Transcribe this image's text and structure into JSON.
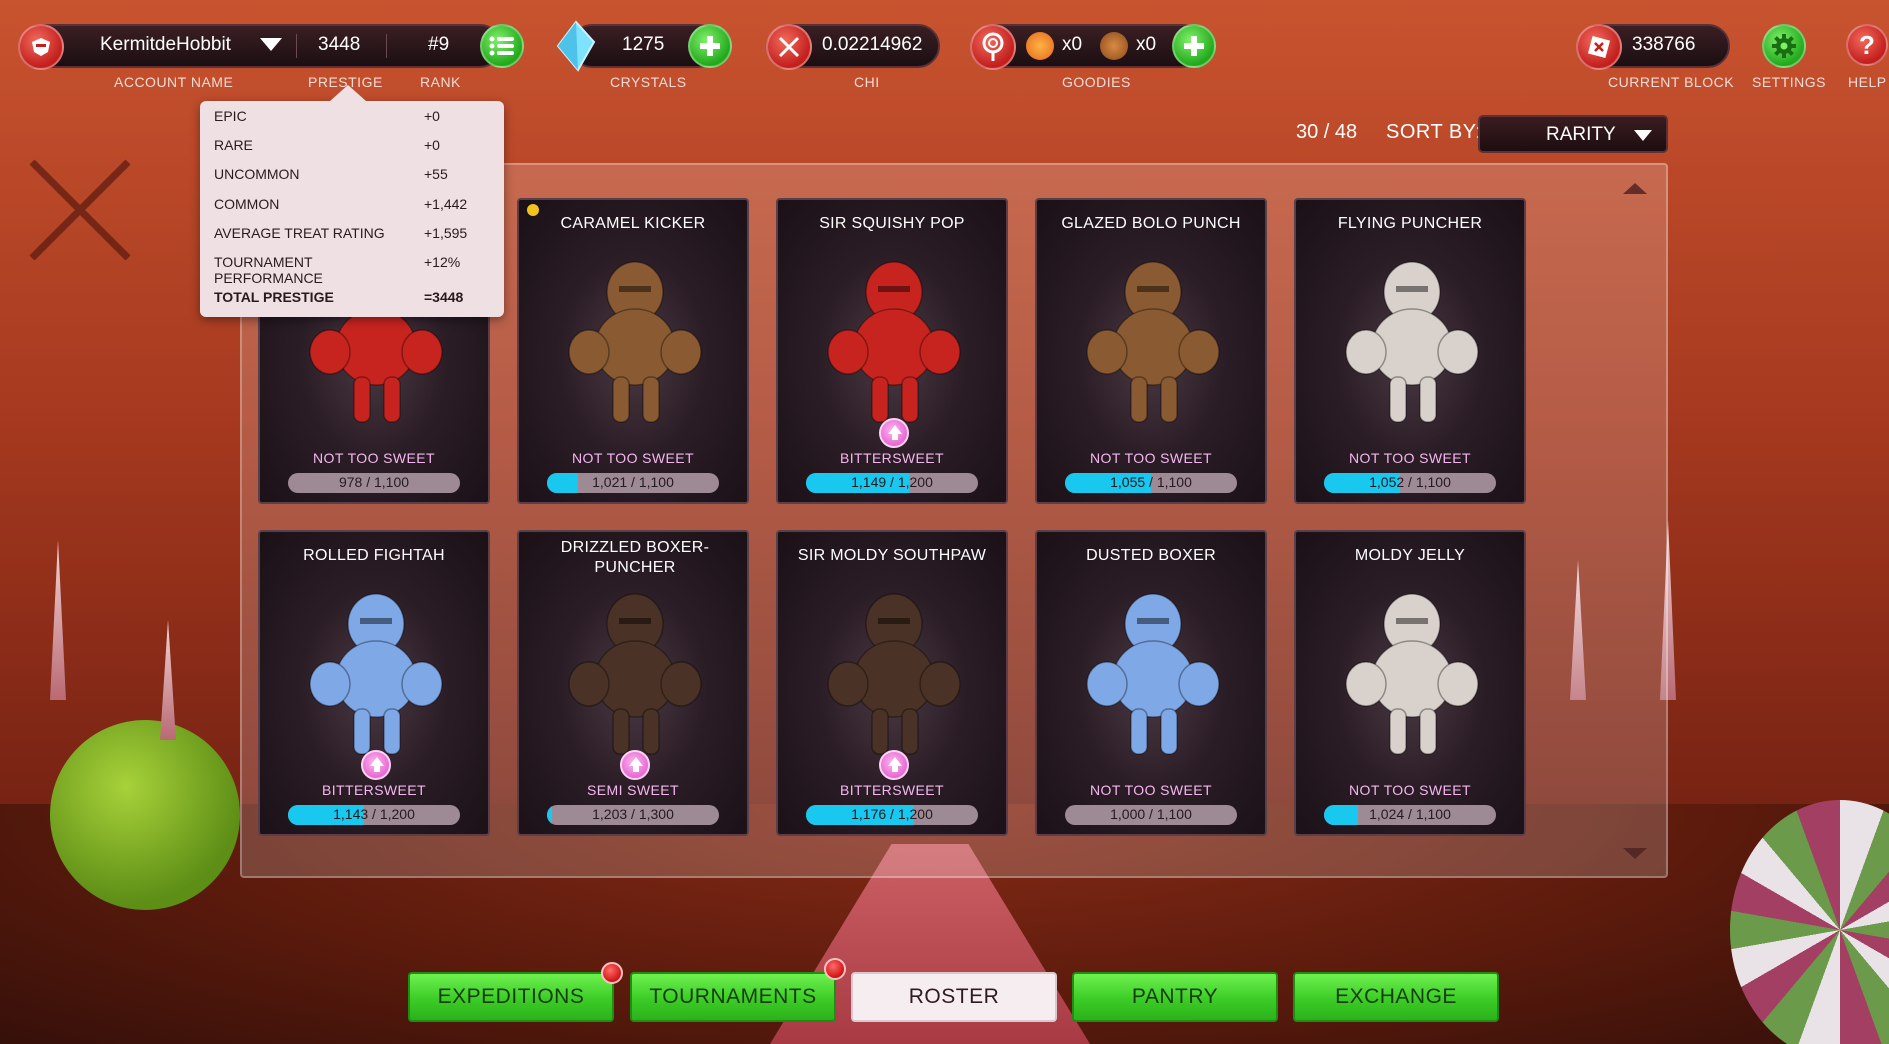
{
  "topbar": {
    "account_name": "KermitdeHobbit",
    "account_label": "ACCOUNT NAME",
    "prestige": "3448",
    "prestige_label": "PRESTIGE",
    "rank": "#9",
    "rank_label": "RANK",
    "crystals": "1275",
    "crystals_label": "CRYSTALS",
    "chi": "0.02214962",
    "chi_label": "CHI",
    "goodies_fire": "x0",
    "goodies_bolt": "x0",
    "goodies_label": "GOODIES",
    "current_block": "338766",
    "current_block_label": "CURRENT BLOCK",
    "settings_label": "SETTINGS",
    "help_label": "HELP"
  },
  "prestige_tooltip": {
    "rows": [
      {
        "key": "EPIC",
        "value": "+0"
      },
      {
        "key": "RARE",
        "value": "+0"
      },
      {
        "key": "UNCOMMON",
        "value": "+55"
      },
      {
        "key": "COMMON",
        "value": "+1,442"
      },
      {
        "key": "AVERAGE TREAT RATING",
        "value": "+1,595"
      },
      {
        "key": "TOURNAMENT PERFORMANCE",
        "value": "+12%"
      }
    ],
    "total_key": "TOTAL PRESTIGE",
    "total_value": "=3448"
  },
  "roster": {
    "count": "30 / 48",
    "sort_label": "SORT BY:",
    "sort_value": "RARITY",
    "cards": [
      {
        "name": "",
        "tier": "NOT TOO SWEET",
        "xp": "978 / 1,100",
        "progress": 0.0,
        "color": "#c8241f",
        "upgrade": false,
        "new": false
      },
      {
        "name": "CARAMEL KICKER",
        "tier": "NOT TOO SWEET",
        "xp": "1,021 / 1,100",
        "progress": 0.18,
        "color": "#8a5a32",
        "upgrade": false,
        "new": true
      },
      {
        "name": "SIR SQUISHY POP",
        "tier": "BITTERSWEET",
        "xp": "1,149 / 1,200",
        "progress": 0.6,
        "color": "#c8241f",
        "upgrade": true,
        "new": false
      },
      {
        "name": "GLAZED BOLO PUNCH",
        "tier": "NOT TOO SWEET",
        "xp": "1,055 / 1,100",
        "progress": 0.5,
        "color": "#8a5a32",
        "upgrade": false,
        "new": false
      },
      {
        "name": "FLYING PUNCHER",
        "tier": "NOT TOO SWEET",
        "xp": "1,052 / 1,100",
        "progress": 0.44,
        "color": "#d9d2cc",
        "upgrade": false,
        "new": false
      },
      {
        "name": "ROLLED FIGHTAH",
        "tier": "BITTERSWEET",
        "xp": "1,143 / 1,200",
        "progress": 0.44,
        "color": "#7fa8e6",
        "upgrade": true,
        "new": false
      },
      {
        "name": "DRIZZLED BOXER-PUNCHER",
        "tier": "SEMI SWEET",
        "xp": "1,203 / 1,300",
        "progress": 0.03,
        "color": "#4a3226",
        "upgrade": true,
        "new": false
      },
      {
        "name": "SIR MOLDY SOUTHPAW",
        "tier": "BITTERSWEET",
        "xp": "1,176 / 1,200",
        "progress": 0.63,
        "color": "#4a3226",
        "upgrade": true,
        "new": false
      },
      {
        "name": "DUSTED BOXER",
        "tier": "NOT TOO SWEET",
        "xp": "1,000 / 1,100",
        "progress": 0.0,
        "color": "#7fa8e6",
        "upgrade": false,
        "new": false
      },
      {
        "name": "MOLDY JELLY",
        "tier": "NOT TOO SWEET",
        "xp": "1,024 / 1,100",
        "progress": 0.2,
        "color": "#d9d2cc",
        "upgrade": false,
        "new": false
      }
    ]
  },
  "nav": {
    "expeditions": "EXPEDITIONS",
    "tournaments": "TOURNAMENTS",
    "roster": "ROSTER",
    "pantry": "PANTRY",
    "exchange": "EXCHANGE"
  }
}
